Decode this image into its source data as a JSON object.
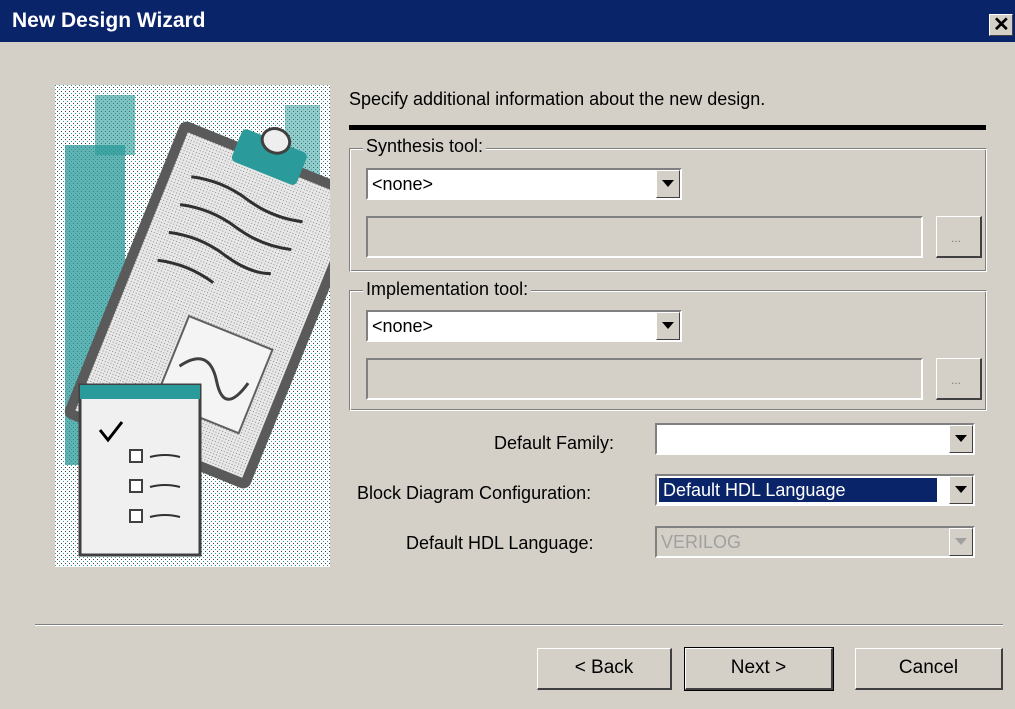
{
  "window": {
    "title": "New Design Wizard",
    "close_glyph": "✕"
  },
  "header": {
    "instruction": "Specify additional information about the new design."
  },
  "synthesis": {
    "legend": "Synthesis tool:",
    "selected": "<none>",
    "path_value": "",
    "browse_label": "..."
  },
  "implementation": {
    "legend": "Implementation tool:",
    "selected": "<none>",
    "path_value": "",
    "browse_label": "..."
  },
  "fields": {
    "default_family": {
      "label": "Default Family:",
      "value": ""
    },
    "block_diagram": {
      "label": "Block Diagram Configuration:",
      "value": "Default HDL Language"
    },
    "default_hdl": {
      "label": "Default HDL Language:",
      "value": "VERILOG"
    }
  },
  "buttons": {
    "back": "< Back",
    "next": "Next >",
    "cancel": "Cancel"
  },
  "icons": {
    "wizard_art": "clipboard-checklist-illustration",
    "dropdown": "chevron-down-icon",
    "close": "close-icon"
  },
  "colors": {
    "titlebar": "#0a246a",
    "dialog": "#d4d0c8",
    "selection": "#0a246a",
    "art_teal": "#2a9a9a"
  }
}
